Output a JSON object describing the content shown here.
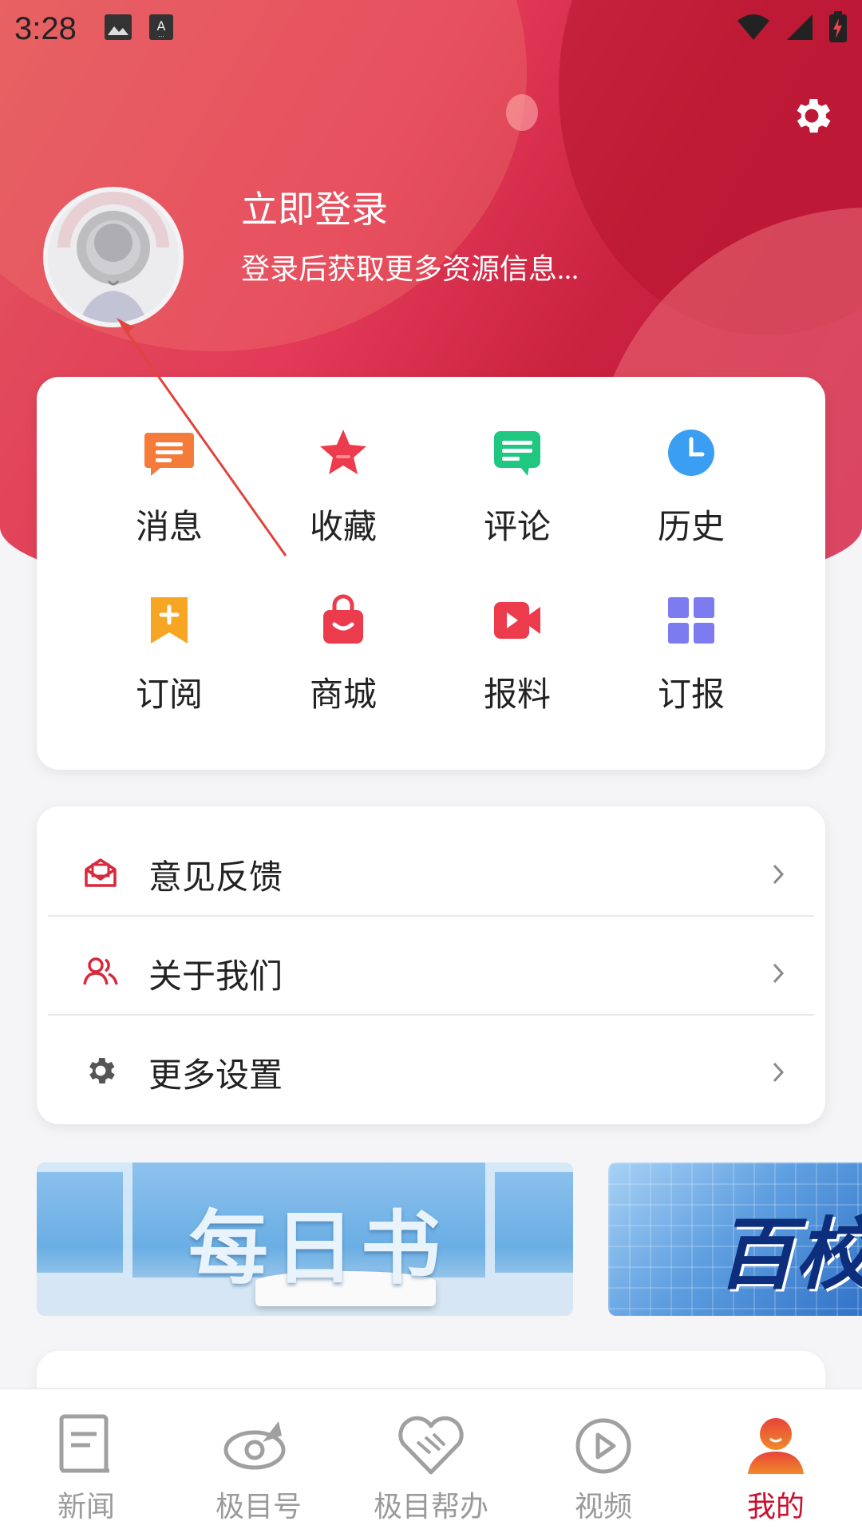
{
  "status_bar": {
    "time": "3:28",
    "left_icons": [
      "image-icon",
      "keyboard-a-icon"
    ],
    "right_icons": [
      "wifi-icon",
      "signal-icon",
      "battery-charging-icon"
    ]
  },
  "header": {
    "login_title": "立即登录",
    "login_subtitle": "登录后获取更多资源信息...",
    "settings_icon": "gear-icon",
    "accent": "#e23a58"
  },
  "quick_grid": [
    {
      "label": "消息",
      "icon": "message-icon",
      "color": "#f47b3a"
    },
    {
      "label": "收藏",
      "icon": "star-icon",
      "color": "#ec3b4c"
    },
    {
      "label": "评论",
      "icon": "comment-icon",
      "color": "#1fc781"
    },
    {
      "label": "历史",
      "icon": "clock-icon",
      "color": "#3a9ef2"
    },
    {
      "label": "订阅",
      "icon": "bookmark-plus-icon",
      "color": "#f6a623"
    },
    {
      "label": "商城",
      "icon": "shopping-bag-icon",
      "color": "#ec3b4c"
    },
    {
      "label": "报料",
      "icon": "video-camera-icon",
      "color": "#ec3b4c"
    },
    {
      "label": "订报",
      "icon": "grid-icon",
      "color": "#7c7cf0"
    }
  ],
  "menu": [
    {
      "label": "意见反馈",
      "icon": "feedback-mail-icon"
    },
    {
      "label": "关于我们",
      "icon": "users-icon"
    },
    {
      "label": "更多设置",
      "icon": "gear-icon"
    }
  ],
  "banners": [
    {
      "title": "每日书"
    },
    {
      "title": "百校"
    }
  ],
  "bottom_nav": [
    {
      "label": "新闻",
      "icon": "news-icon",
      "active": false
    },
    {
      "label": "极目号",
      "icon": "jimuhao-icon",
      "active": false
    },
    {
      "label": "极目帮办",
      "icon": "handshake-heart-icon",
      "active": false
    },
    {
      "label": "视频",
      "icon": "play-circle-icon",
      "active": false
    },
    {
      "label": "我的",
      "icon": "person-icon",
      "active": true
    }
  ],
  "colors": {
    "active_nav": "#c8102e",
    "inactive_nav": "#9a9a9a",
    "annotation_arrow": "#e0443e"
  }
}
